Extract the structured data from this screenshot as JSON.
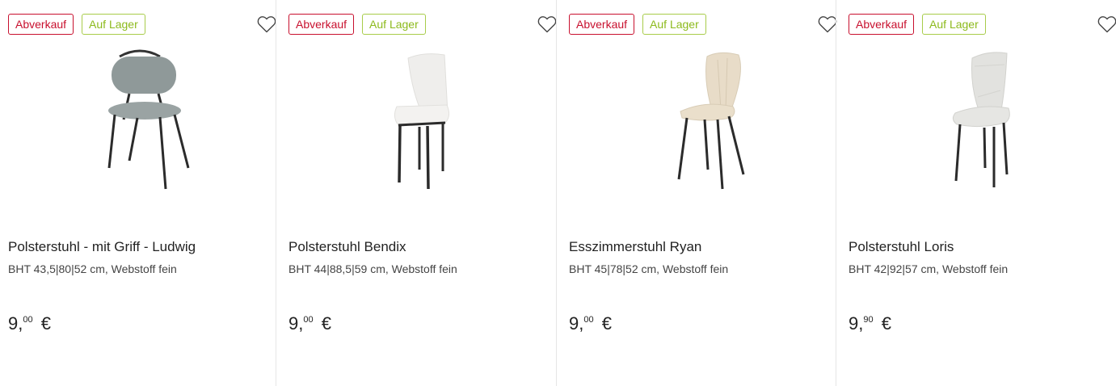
{
  "products": [
    {
      "badge_sale": "Abverkauf",
      "badge_stock": "Auf Lager",
      "title": "Polsterstuhl - mit Griff - Ludwig",
      "subtitle": "BHT 43,5|80|52 cm, Webstoff fein",
      "price_main": "9,",
      "price_cents": "00",
      "currency": "€",
      "chair_color": "#8f9999",
      "image_icon": "chair-with-handle"
    },
    {
      "badge_sale": "Abverkauf",
      "badge_stock": "Auf Lager",
      "title": "Polsterstuhl Bendix",
      "subtitle": "BHT 44|88,5|59 cm, Webstoff fein",
      "price_main": "9,",
      "price_cents": "00",
      "currency": "€",
      "chair_color": "#efeeec",
      "image_icon": "chair"
    },
    {
      "badge_sale": "Abverkauf",
      "badge_stock": "Auf Lager",
      "title": "Esszimmerstuhl Ryan",
      "subtitle": "BHT 45|78|52 cm, Webstoff fein",
      "price_main": "9,",
      "price_cents": "00",
      "currency": "€",
      "chair_color": "#e8dcc8",
      "image_icon": "chair"
    },
    {
      "badge_sale": "Abverkauf",
      "badge_stock": "Auf Lager",
      "title": "Polsterstuhl Loris",
      "subtitle": "BHT 42|92|57 cm, Webstoff fein",
      "price_main": "9,",
      "price_cents": "90",
      "currency": "€",
      "chair_color": "#e2e2df",
      "image_icon": "chair"
    }
  ],
  "colors": {
    "sale": "#c8102e",
    "stock": "#8cba1c",
    "divider": "#e6e6e6"
  }
}
